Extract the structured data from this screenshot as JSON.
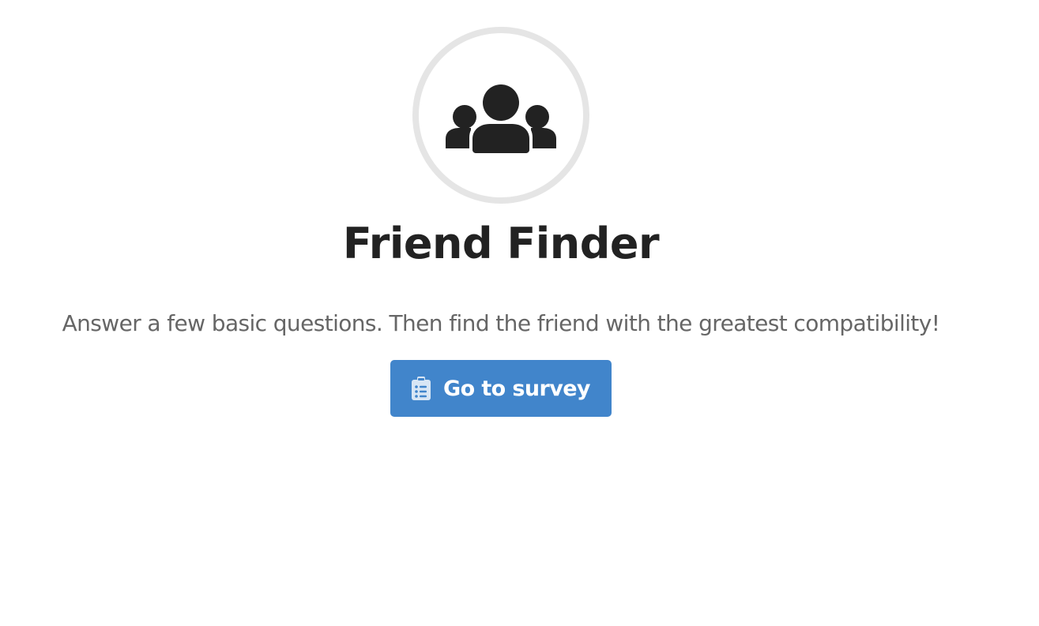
{
  "header": {
    "logo_icon": "users-icon",
    "title": "Friend Finder"
  },
  "main": {
    "tagline": "Answer a few basic questions. Then find the friend with the greatest compatibility!",
    "survey_button": {
      "label": "Go to survey",
      "icon": "clipboard-list-icon"
    }
  },
  "colors": {
    "button_bg": "#4185cb",
    "title_text": "#222222",
    "tagline_text": "#666666",
    "circle_border": "#e5e5e5"
  }
}
